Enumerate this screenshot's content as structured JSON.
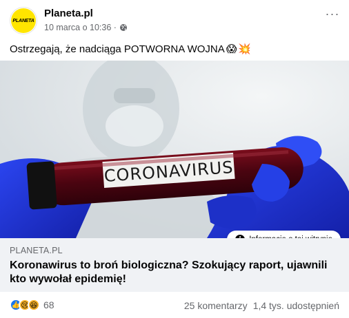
{
  "post": {
    "page_name": "Planeta.pl",
    "avatar_text": "PLANETA",
    "timestamp": "10 marca o 10:36 ·",
    "more_label": "···",
    "text": "Ostrzegają, że nadciąga POTWORNA WOJNA",
    "text_emojis": [
      "😱",
      "💥"
    ]
  },
  "image": {
    "tube_label": "CORONAVIRUS",
    "info_button": "Informacje o tej witrynie",
    "info_icon": "i"
  },
  "link": {
    "domain": "PLANETA.PL",
    "headline": "Koronawirus to broń biologiczna? Szokujący raport, ujawnili kto wywołał epidemię!"
  },
  "footer": {
    "reaction_icons": [
      "like-icon",
      "sad-icon",
      "haha-icon"
    ],
    "reaction_count": "68",
    "comments": "25 komentarzy",
    "shares": "1,4 tys. udostępnień"
  },
  "colors": {
    "like_blue": "#1877f2",
    "secondary_text": "#65676b",
    "link_bg": "#f0f2f5",
    "glove_blue": "#1c2fd0",
    "tube_red": "#5a0612"
  }
}
